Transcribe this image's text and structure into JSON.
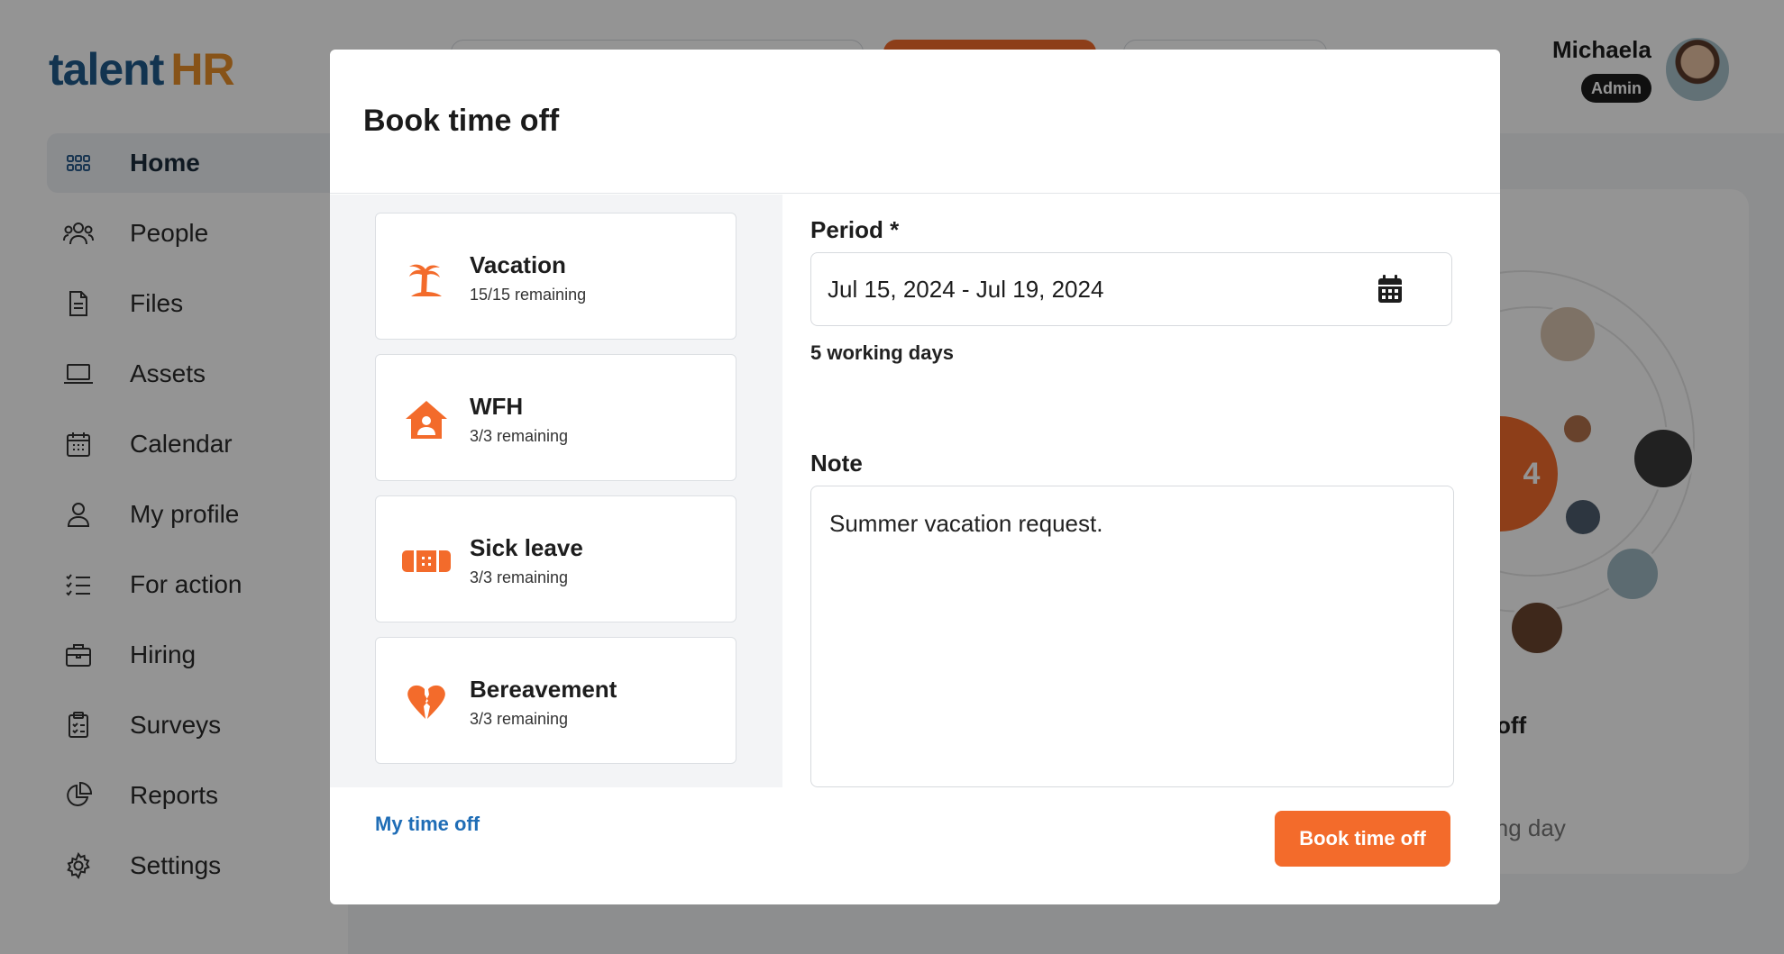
{
  "app": {
    "logo_text": "talent",
    "logo_accent": "HR",
    "colors": {
      "accent": "#f36b2b",
      "brand": "#1f5a8a",
      "link": "#1f6db6"
    }
  },
  "user": {
    "name": "Michaela",
    "role": "Admin"
  },
  "sidebar": {
    "items": [
      {
        "label": "Home",
        "icon": "grid-icon",
        "active": true
      },
      {
        "label": "People",
        "icon": "people-icon"
      },
      {
        "label": "Files",
        "icon": "file-icon"
      },
      {
        "label": "Assets",
        "icon": "laptop-icon"
      },
      {
        "label": "Calendar",
        "icon": "calendar-icon"
      },
      {
        "label": "My profile",
        "icon": "user-icon"
      },
      {
        "label": "For action",
        "icon": "checklist-icon"
      },
      {
        "label": "Hiring",
        "icon": "briefcase-icon"
      },
      {
        "label": "Surveys",
        "icon": "clipboard-icon"
      },
      {
        "label": "Reports",
        "icon": "pie-chart-icon"
      },
      {
        "label": "Settings",
        "icon": "gear-icon"
      }
    ]
  },
  "background": {
    "partial_off": "off",
    "partial_day": "ving day",
    "badge_partial": "4"
  },
  "modal": {
    "title": "Book time off",
    "types": [
      {
        "name": "Vacation",
        "remaining": "15/15 remaining",
        "icon": "palm-tree-icon"
      },
      {
        "name": "WFH",
        "remaining": "3/3 remaining",
        "icon": "home-user-icon"
      },
      {
        "name": "Sick leave",
        "remaining": "3/3 remaining",
        "icon": "bandage-icon"
      },
      {
        "name": "Bereavement",
        "remaining": "3/3 remaining",
        "icon": "broken-heart-icon"
      }
    ],
    "period": {
      "label": "Period *",
      "value": "Jul 15, 2024 - Jul 19, 2024",
      "working_days": "5 working days"
    },
    "note": {
      "label": "Note",
      "value": "Summer vacation request."
    },
    "footer": {
      "link": "My time off",
      "submit": "Book time off"
    }
  }
}
